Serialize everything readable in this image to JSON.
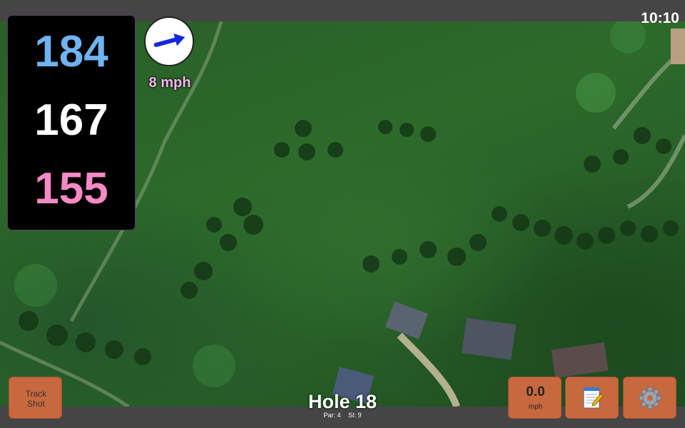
{
  "clock": "10:10",
  "distances": {
    "back": "184",
    "middle": "167",
    "front": "155"
  },
  "wind": {
    "speed": "8 mph",
    "icon": "wind-arrow-icon",
    "direction_deg": -15
  },
  "hole": {
    "title": "Hole 18",
    "par": "Par: 4",
    "stroke_index": "SI: 9"
  },
  "buttons": {
    "track_shot": [
      "Track",
      "Shot"
    ],
    "speed_value": "0.0",
    "speed_unit": "mph",
    "notes_icon": "notepad-icon",
    "settings_icon": "gear-icon"
  },
  "colors": {
    "back_distance": "#6fb3f0",
    "middle_distance": "#ffffff",
    "front_distance": "#f78ac4",
    "button": "#c8683f",
    "wind_label": "#f6b6ee"
  }
}
